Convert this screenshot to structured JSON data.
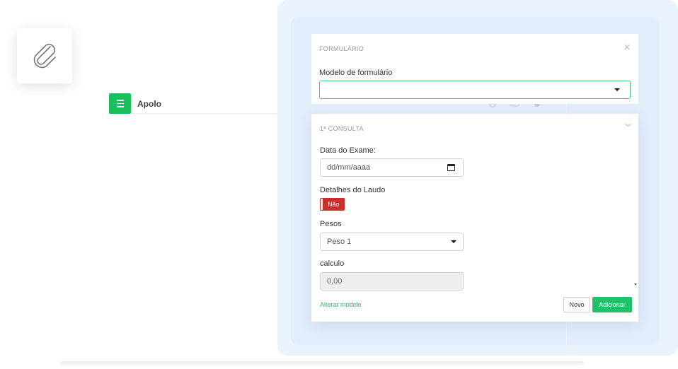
{
  "background_app": {
    "title": "Apolo",
    "menu_icon": "hamburger-icon",
    "accent": "#1bbf5c"
  },
  "attachment_icon": "paperclip-icon",
  "form_modal": {
    "title": "FORMULÁRIO",
    "close_icon": "close-icon",
    "model_label": "Modelo de formulário",
    "model_value": ""
  },
  "consult_modal": {
    "title": "1ª CONSULTA",
    "collapse_icon": "chevrons-down-icon",
    "exam_date_label": "Data do Exame:",
    "exam_date_placeholder": "dd/mm/aaaa",
    "report_details_label": "Detalhes do Laudo",
    "report_details_toggle": "Não",
    "weights_label": "Pesos",
    "weights_value": "Peso 1",
    "calc_label": "calculo",
    "calc_value": "0,00",
    "change_model_link": "Alterar modelo",
    "new_button": "Novo",
    "add_button": "Adicionar"
  },
  "colors": {
    "primary_green": "#21c06a",
    "toggle_red": "#c9302c",
    "overlay_blue": "#eaf2fd"
  }
}
